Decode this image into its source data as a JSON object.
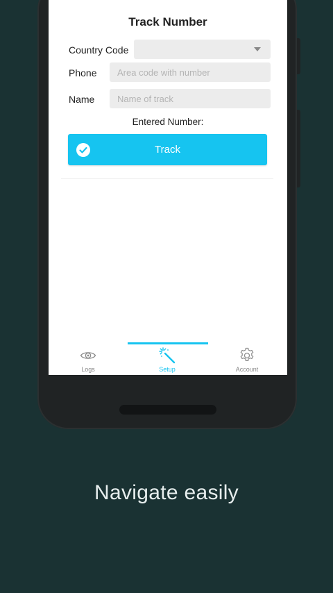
{
  "colors": {
    "background": "#1a3233",
    "accent": "#16c4f0",
    "field_bg": "#ececec"
  },
  "form": {
    "title": "Track Number",
    "country_code_label": "Country Code",
    "country_code_value": "",
    "phone_label": "Phone",
    "phone_placeholder": "Area code with number",
    "phone_value": "",
    "name_label": "Name",
    "name_placeholder": "Name of track",
    "name_value": "",
    "entered_number_label": "Entered Number:",
    "track_button_label": "Track",
    "track_button_icon": "check-circle-icon"
  },
  "tabs": [
    {
      "label": "Logs",
      "icon": "eye-icon",
      "active": false
    },
    {
      "label": "Setup",
      "icon": "magic-wand-icon",
      "active": true
    },
    {
      "label": "Account",
      "icon": "gear-icon",
      "active": false
    }
  ],
  "tagline": "Navigate easily"
}
